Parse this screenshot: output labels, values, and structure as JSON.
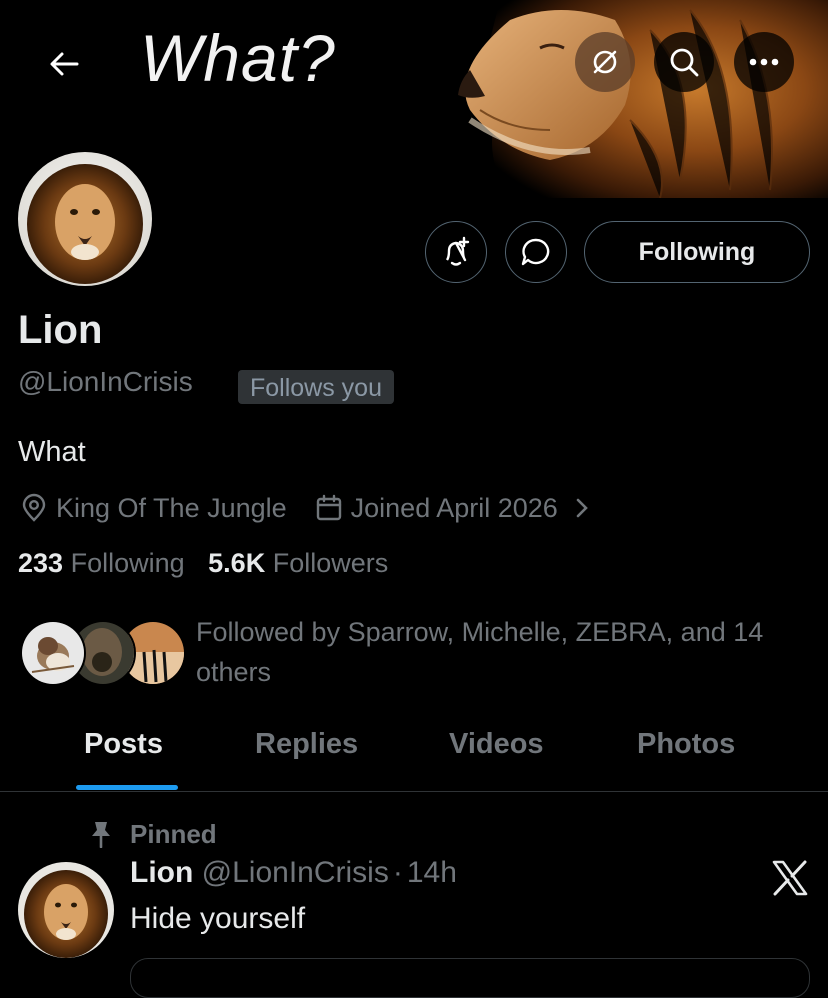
{
  "header": {
    "banner_title": "What?",
    "icons": [
      "back-arrow-icon",
      "auto-rotate-off-icon",
      "search-icon",
      "more-icon"
    ]
  },
  "profile": {
    "name": "Lion",
    "handle": "@LionInCrisis",
    "follows_you": "Follows you",
    "bio": "What",
    "location": "King Of The Jungle",
    "joined": "Joined April 2026",
    "following_count": "233",
    "following_label": "Following",
    "followers_count": "5.6K",
    "followers_label": "Followers",
    "followed_by": "Followed by Sparrow, Michelle, ZEBRA, and 14 others"
  },
  "actions": {
    "following_button": "Following"
  },
  "tabs": [
    {
      "label": "Posts",
      "active": true
    },
    {
      "label": "Replies"
    },
    {
      "label": "Videos"
    },
    {
      "label": "Photos"
    }
  ],
  "pinned_post": {
    "pinned_label": "Pinned",
    "author_name": "Lion",
    "author_handle": "@LionInCrisis",
    "separator": "·",
    "time": "14h",
    "text": "Hide yourself"
  },
  "colors": {
    "background": "#000000",
    "text_primary": "#e7e9ea",
    "text_secondary": "#71767b",
    "accent": "#1d9bf0",
    "border": "#2f3336"
  }
}
